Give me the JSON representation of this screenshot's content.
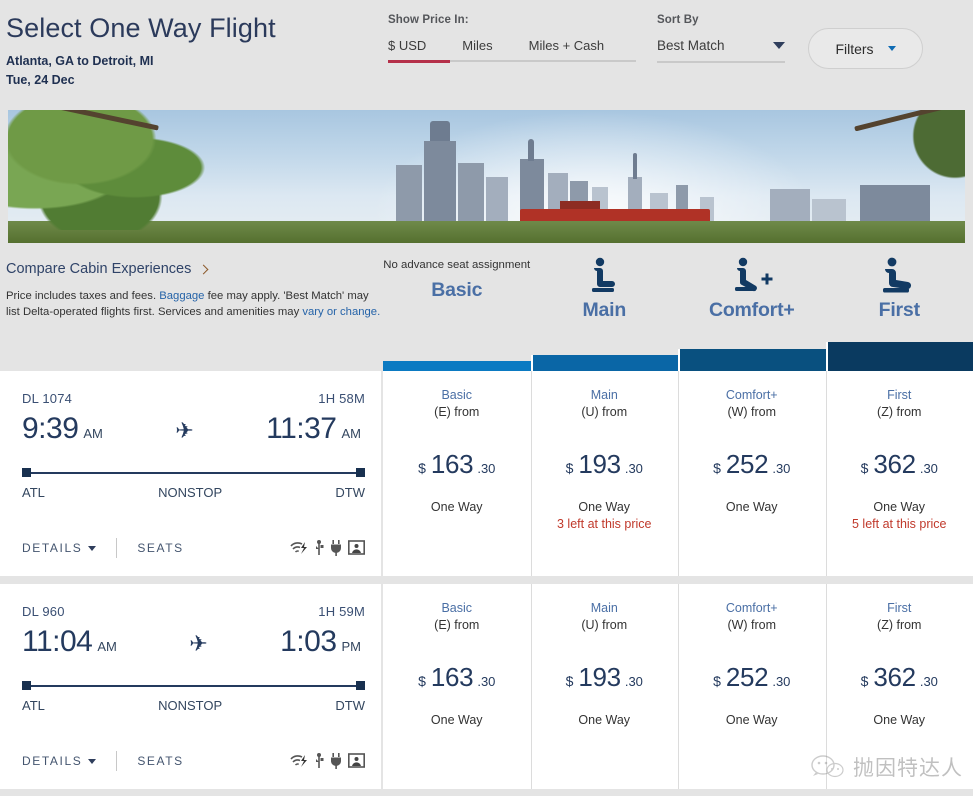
{
  "header": {
    "title": "Select One Way Flight",
    "route": "Atlanta, GA to Detroit, MI",
    "date": "Tue, 24 Dec",
    "price_in_label": "Show Price In:",
    "price_tabs": [
      {
        "label": "$ USD",
        "active": true
      },
      {
        "label": "Miles",
        "active": false
      },
      {
        "label": "Miles + Cash",
        "active": false
      }
    ],
    "sort_by_label": "Sort By",
    "sort_by_value": "Best Match",
    "filters_label": "Filters",
    "accent_red": "#b5304a"
  },
  "compare": {
    "link": "Compare Cabin Experiences",
    "disclaimer_1": "Price includes taxes and fees. ",
    "disclaimer_baggage": "Baggage",
    "disclaimer_2": " fee may apply.  'Best Match' may list Delta-operated flights first. Services and amenities may ",
    "disclaimer_vary": "vary or change.",
    "no_advance_seat": "No advance seat assignment"
  },
  "cabins": [
    {
      "name": "Basic",
      "icon": "none",
      "bar_color": "#0b7ac2"
    },
    {
      "name": "Main",
      "icon": "seat-icon",
      "bar_color": "#0a66a6"
    },
    {
      "name": "Comfort+",
      "icon": "seat-plus-icon",
      "bar_color": "#09507f"
    },
    {
      "name": "First",
      "icon": "seat-first-icon",
      "bar_color": "#0a3a60"
    }
  ],
  "flights": [
    {
      "flight_number": "DL 1074",
      "duration": "1H 58M",
      "depart_time": "9:39",
      "depart_ampm": "AM",
      "arrive_time": "11:37",
      "arrive_ampm": "AM",
      "origin": "ATL",
      "stops": "NONSTOP",
      "destination": "DTW",
      "details_label": "DETAILS",
      "seats_label": "SEATS",
      "fares": [
        {
          "cabin": "Basic",
          "class": "(E) from",
          "currency": "$",
          "dollars": "163",
          "cents": ".30",
          "term": "One Way",
          "left": ""
        },
        {
          "cabin": "Main",
          "class": "(U) from",
          "currency": "$",
          "dollars": "193",
          "cents": ".30",
          "term": "One Way",
          "left": "3 left at this price"
        },
        {
          "cabin": "Comfort+",
          "class": "(W) from",
          "currency": "$",
          "dollars": "252",
          "cents": ".30",
          "term": "One Way",
          "left": ""
        },
        {
          "cabin": "First",
          "class": "(Z) from",
          "currency": "$",
          "dollars": "362",
          "cents": ".30",
          "term": "One Way",
          "left": "5 left at this price"
        }
      ]
    },
    {
      "flight_number": "DL 960",
      "duration": "1H 59M",
      "depart_time": "11:04",
      "depart_ampm": "AM",
      "arrive_time": "1:03",
      "arrive_ampm": "PM",
      "origin": "ATL",
      "stops": "NONSTOP",
      "destination": "DTW",
      "details_label": "DETAILS",
      "seats_label": "SEATS",
      "fares": [
        {
          "cabin": "Basic",
          "class": "(E) from",
          "currency": "$",
          "dollars": "163",
          "cents": ".30",
          "term": "One Way",
          "left": ""
        },
        {
          "cabin": "Main",
          "class": "(U) from",
          "currency": "$",
          "dollars": "193",
          "cents": ".30",
          "term": "One Way",
          "left": ""
        },
        {
          "cabin": "Comfort+",
          "class": "(W) from",
          "currency": "$",
          "dollars": "252",
          "cents": ".30",
          "term": "One Way",
          "left": ""
        },
        {
          "cabin": "First",
          "class": "(Z) from",
          "currency": "$",
          "dollars": "362",
          "cents": ".30",
          "term": "One Way",
          "left": ""
        }
      ]
    }
  ],
  "amenities": [
    "wifi-streaming-icon",
    "usb-icon",
    "power-outlet-icon",
    "entertainment-screen-icon"
  ],
  "watermark": {
    "text": "抛因特达人"
  }
}
